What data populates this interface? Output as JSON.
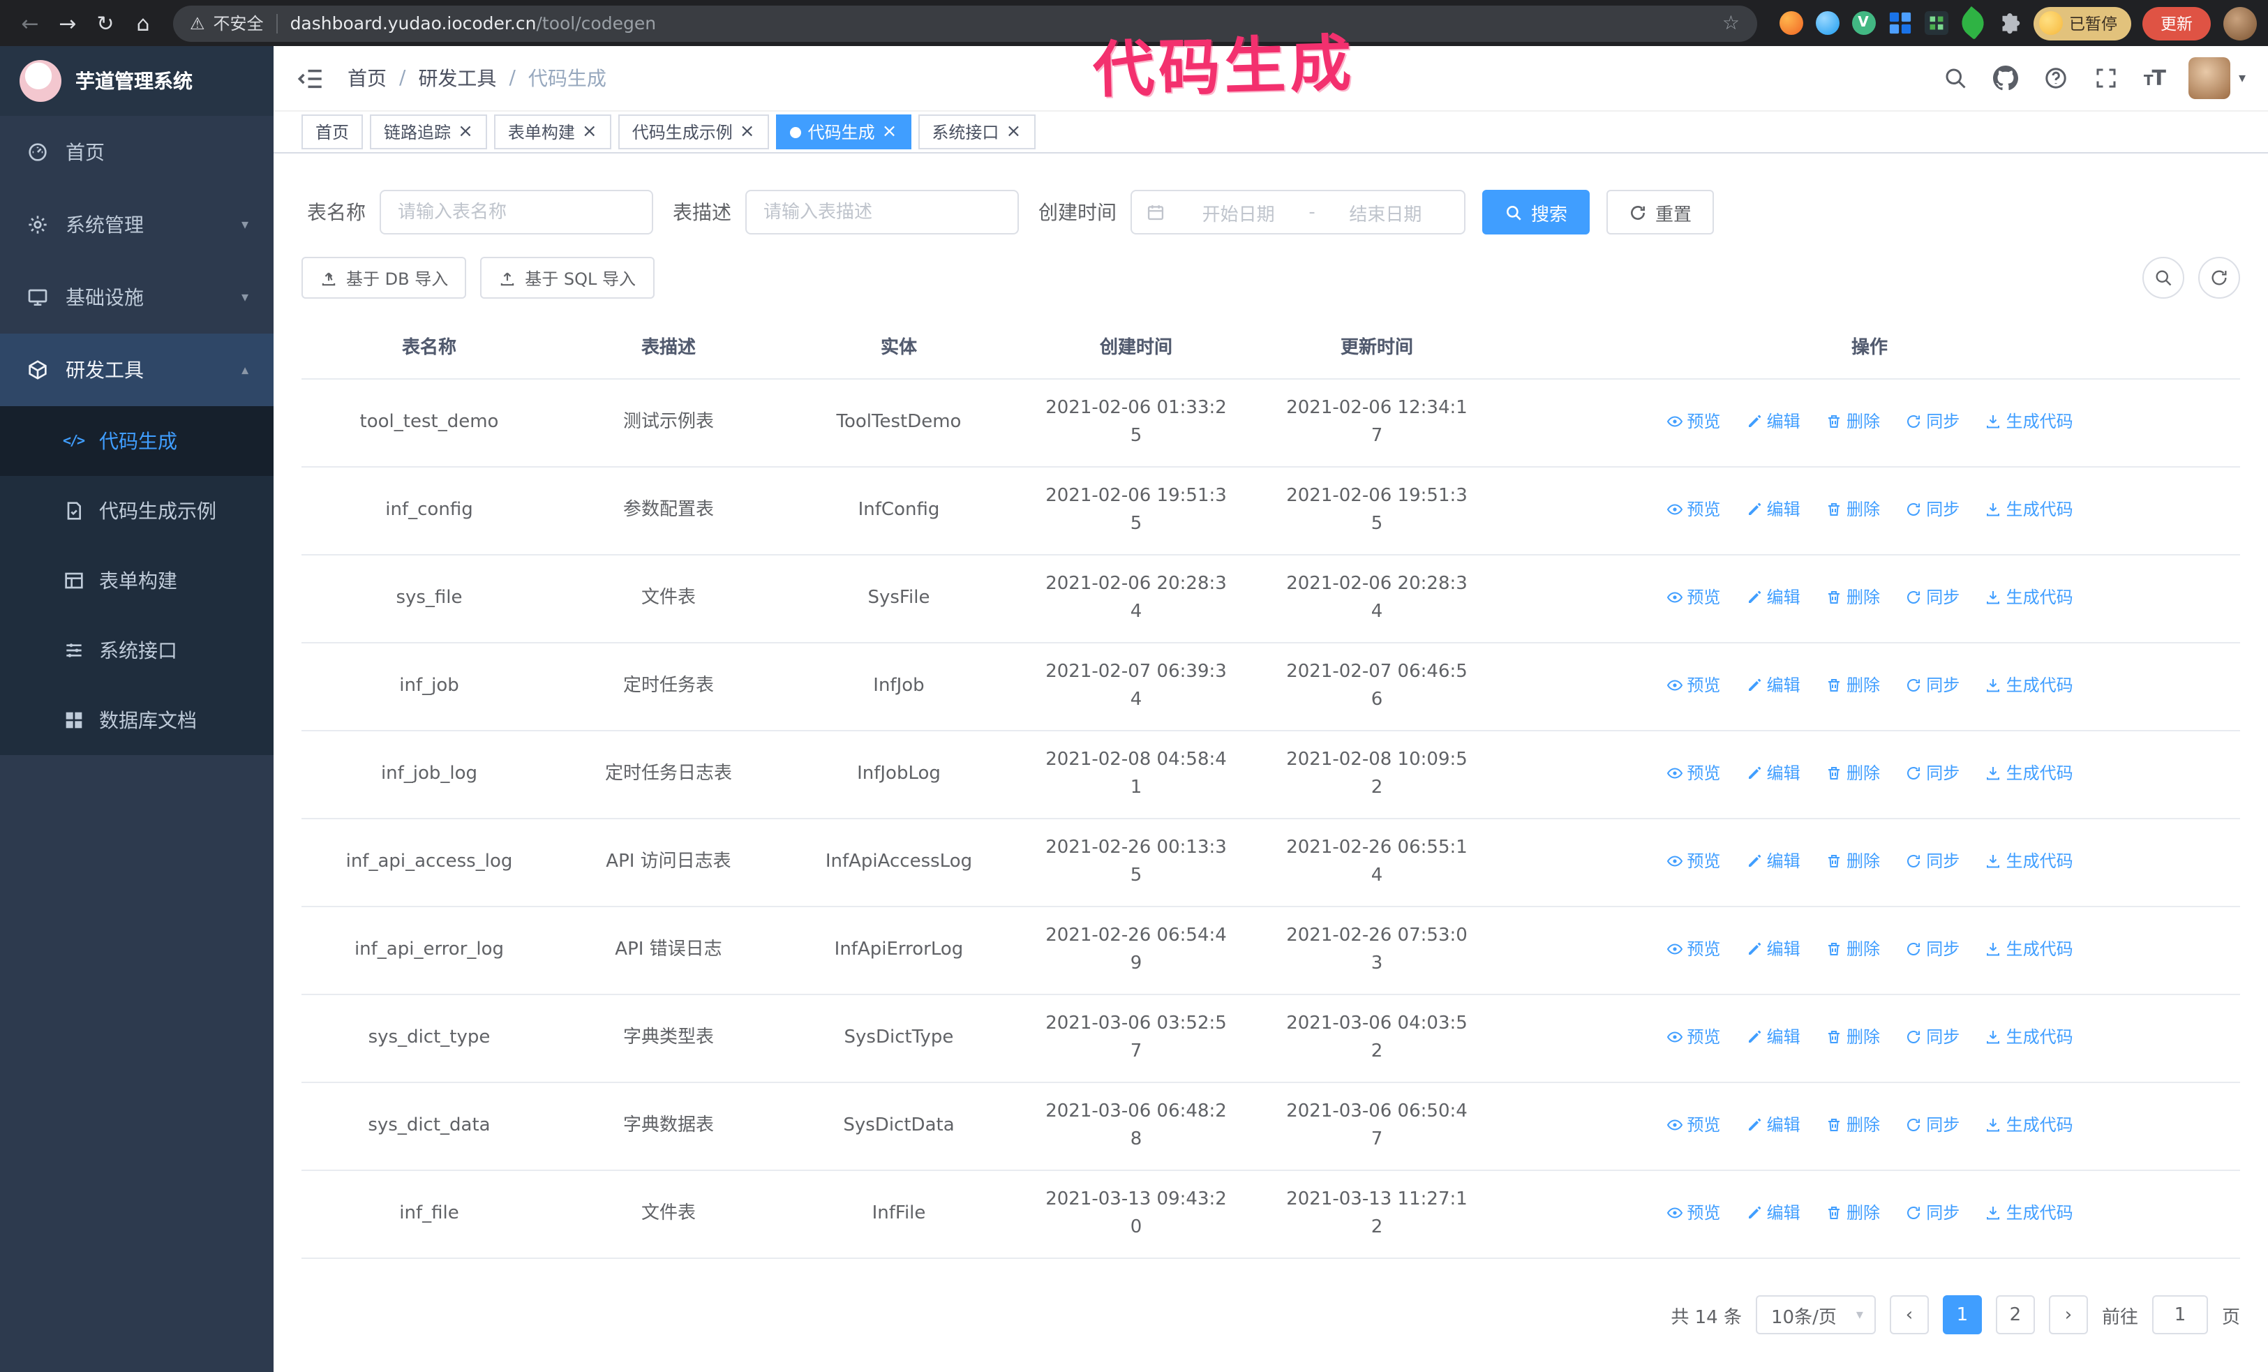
{
  "browser": {
    "security_label": "不安全",
    "url_host": "dashboard.yudao.iocoder.cn",
    "url_path": "/tool/codegen",
    "paused_chip": "已暂停",
    "update_button": "更新"
  },
  "annotation": "代码生成",
  "glyphs": {
    "back": "←",
    "forward": "→",
    "reload": "↻",
    "home": "⌂",
    "warning": "⚠",
    "star": "☆",
    "caret": "▾",
    "close": "×",
    "prev": "‹",
    "next": "›",
    "slash": "/",
    "dash": "-",
    "vue": "V"
  },
  "colors": {
    "primary": "#409eff",
    "annotation": "#f3306e",
    "sidebar": "#2d3a4e",
    "sidebar_sub": "#1f2d3d",
    "update": "#df5344",
    "paused": "#e2c27c",
    "chrome": "#202124"
  },
  "sidebar": {
    "logo_title": "芋道管理系统",
    "items": [
      {
        "label": "首页"
      },
      {
        "label": "系统管理"
      },
      {
        "label": "基础设施"
      },
      {
        "label": "研发工具"
      }
    ],
    "submenu": [
      {
        "label": "代码生成"
      },
      {
        "label": "代码生成示例"
      },
      {
        "label": "表单构建"
      },
      {
        "label": "系统接口"
      },
      {
        "label": "数据库文档"
      }
    ]
  },
  "breadcrumb": [
    "首页",
    "研发工具",
    "代码生成"
  ],
  "tabs": [
    {
      "label": "首页"
    },
    {
      "label": "链路追踪"
    },
    {
      "label": "表单构建"
    },
    {
      "label": "代码生成示例"
    },
    {
      "label": "代码生成"
    },
    {
      "label": "系统接口"
    }
  ],
  "filters": {
    "table_name_label": "表名称",
    "table_name_placeholder": "请输入表名称",
    "table_desc_label": "表描述",
    "table_desc_placeholder": "请输入表描述",
    "create_time_label": "创建时间",
    "date_start_placeholder": "开始日期",
    "date_end_placeholder": "结束日期",
    "search_button": "搜索",
    "reset_button": "重置"
  },
  "toolbar": {
    "import_db_button": "基于 DB 导入",
    "import_sql_button": "基于 SQL 导入"
  },
  "table": {
    "columns": [
      "表名称",
      "表描述",
      "实体",
      "创建时间",
      "更新时间",
      "操作"
    ],
    "ops": [
      "预览",
      "编辑",
      "删除",
      "同步",
      "生成代码"
    ],
    "rows": [
      {
        "name": "tool_test_demo",
        "desc": "测试示例表",
        "entity": "ToolTestDemo",
        "created": "2021-02-06 01:33:25",
        "updated": "2021-02-06 12:34:17"
      },
      {
        "name": "inf_config",
        "desc": "参数配置表",
        "entity": "InfConfig",
        "created": "2021-02-06 19:51:35",
        "updated": "2021-02-06 19:51:35"
      },
      {
        "name": "sys_file",
        "desc": "文件表",
        "entity": "SysFile",
        "created": "2021-02-06 20:28:34",
        "updated": "2021-02-06 20:28:34"
      },
      {
        "name": "inf_job",
        "desc": "定时任务表",
        "entity": "InfJob",
        "created": "2021-02-07 06:39:34",
        "updated": "2021-02-07 06:46:56"
      },
      {
        "name": "inf_job_log",
        "desc": "定时任务日志表",
        "entity": "InfJobLog",
        "created": "2021-02-08 04:58:41",
        "updated": "2021-02-08 10:09:52"
      },
      {
        "name": "inf_api_access_log",
        "desc": "API 访问日志表",
        "entity": "InfApiAccessLog",
        "created": "2021-02-26 00:13:35",
        "updated": "2021-02-26 06:55:14"
      },
      {
        "name": "inf_api_error_log",
        "desc": "API 错误日志",
        "entity": "InfApiErrorLog",
        "created": "2021-02-26 06:54:49",
        "updated": "2021-02-26 07:53:03"
      },
      {
        "name": "sys_dict_type",
        "desc": "字典类型表",
        "entity": "SysDictType",
        "created": "2021-03-06 03:52:57",
        "updated": "2021-03-06 04:03:52"
      },
      {
        "name": "sys_dict_data",
        "desc": "字典数据表",
        "entity": "SysDictData",
        "created": "2021-03-06 06:48:28",
        "updated": "2021-03-06 06:50:47"
      },
      {
        "name": "inf_file",
        "desc": "文件表",
        "entity": "InfFile",
        "created": "2021-03-13 09:43:20",
        "updated": "2021-03-13 11:27:12"
      }
    ]
  },
  "pagination": {
    "total_text": "共 14 条",
    "page_size": "10条/页",
    "pages": [
      "1",
      "2"
    ],
    "active_page": "1",
    "goto_label": "前往",
    "goto_value": "1",
    "goto_suffix": "页"
  }
}
